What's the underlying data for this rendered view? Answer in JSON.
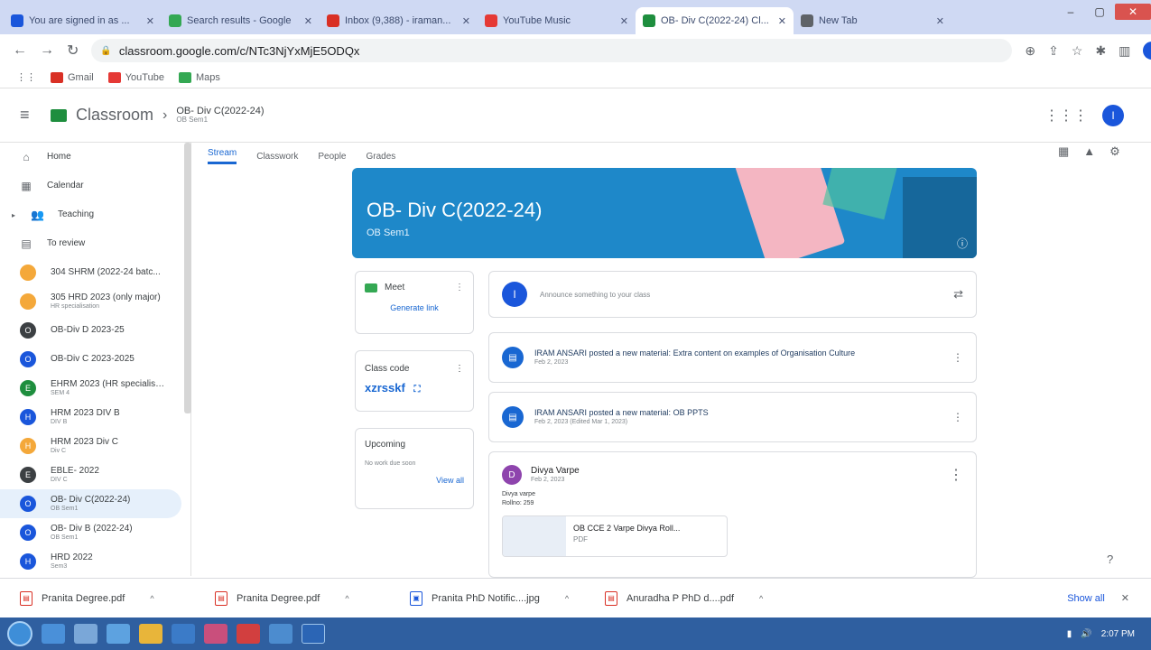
{
  "browser": {
    "tabs": [
      {
        "title": "You are signed in as ...",
        "color": "#1a56db"
      },
      {
        "title": "Search results - Google",
        "color": "#34a853"
      },
      {
        "title": "Inbox (9,388) - iraman...",
        "color": "#d93025"
      },
      {
        "title": "YouTube Music",
        "color": "#e53935"
      },
      {
        "title": "OB- Div C(2022-24) Cl...",
        "color": "#1e8e3e",
        "active": true
      },
      {
        "title": "New Tab",
        "color": "#5f6368"
      }
    ],
    "url": "classroom.google.com/c/NTc3NjYxMjE5ODQx"
  },
  "bookmarks": [
    {
      "label": "Gmail",
      "color": "#d93025"
    },
    {
      "label": "YouTube",
      "color": "#e53935"
    },
    {
      "label": "Maps",
      "color": "#34a853"
    }
  ],
  "header": {
    "brand": "Classroom",
    "crumb_title": "OB- Div C(2022-24)",
    "crumb_sub": "OB Sem1",
    "avatar": "I"
  },
  "sidebar": {
    "home": "Home",
    "calendar": "Calendar",
    "teaching": "Teaching",
    "to_review": "To review",
    "classes": [
      {
        "name": "304 SHRM (2022-24 batc...",
        "sub": "",
        "letter": "",
        "color": "#f4a83a"
      },
      {
        "name": "305 HRD 2023 (only major)",
        "sub": "HR specialisation",
        "letter": "",
        "color": "#f4a83a"
      },
      {
        "name": "OB-Div D 2023-25",
        "sub": "",
        "letter": "O",
        "color": "#3c4043"
      },
      {
        "name": "OB-Div C 2023-2025",
        "sub": "",
        "letter": "O",
        "color": "#1a56db"
      },
      {
        "name": "EHRM 2023 (HR specialisa...",
        "sub": "SEM 4",
        "letter": "E",
        "color": "#1e8e3e"
      },
      {
        "name": "HRM 2023 DIV B",
        "sub": "DIV B",
        "letter": "H",
        "color": "#1a56db"
      },
      {
        "name": "HRM 2023 Div C",
        "sub": "Div C",
        "letter": "H",
        "color": "#f4a83a"
      },
      {
        "name": "EBLE- 2022",
        "sub": "DIV C",
        "letter": "E",
        "color": "#3c4043"
      },
      {
        "name": "OB- Div C(2022-24)",
        "sub": "OB Sem1",
        "letter": "O",
        "color": "#1a56db",
        "active": true
      },
      {
        "name": "OB- Div B (2022-24)",
        "sub": "OB Sem1",
        "letter": "O",
        "color": "#1a56db"
      },
      {
        "name": "HRD 2022",
        "sub": "Sem3",
        "letter": "H",
        "color": "#1a56db"
      }
    ]
  },
  "tabs": {
    "stream": "Stream",
    "classwork": "Classwork",
    "people": "People",
    "grades": "Grades"
  },
  "banner": {
    "title": "OB- Div C(2022-24)",
    "subtitle": "OB Sem1",
    "color": "#1e88c9"
  },
  "meet": {
    "label": "Meet",
    "generate": "Generate link"
  },
  "class_code": {
    "label": "Class code",
    "value": "xzrsskf"
  },
  "upcoming": {
    "label": "Upcoming",
    "none": "No work due soon",
    "view_all": "View all"
  },
  "announce": {
    "avatar": "I",
    "placeholder": "Announce something to your class"
  },
  "posts": [
    {
      "text": "IRAM ANSARI posted a new material: Extra content on examples of Organisation Culture",
      "date": "Feb 2, 2023"
    },
    {
      "text": "IRAM ANSARI posted a new material: OB PPTS",
      "date": "Feb 2, 2023 (Edited Mar 1, 2023)"
    }
  ],
  "comment": {
    "avatar": "D",
    "name": "Divya Varpe",
    "date": "Feb 2, 2023",
    "line1": "Divya varpe",
    "line2": "Rollno: 259",
    "attachment_title": "OB CCE 2 Varpe Divya Roll...",
    "attachment_type": "PDF"
  },
  "downloads": [
    {
      "name": "Pranita Degree.pdf",
      "kind": "pdf"
    },
    {
      "name": "Pranita Degree.pdf",
      "kind": "pdf"
    },
    {
      "name": "Pranita PhD Notific....jpg",
      "kind": "img"
    },
    {
      "name": "Anuradha P PhD d....pdf",
      "kind": "pdf"
    }
  ],
  "show_all": "Show all",
  "clock": "2:07 PM"
}
